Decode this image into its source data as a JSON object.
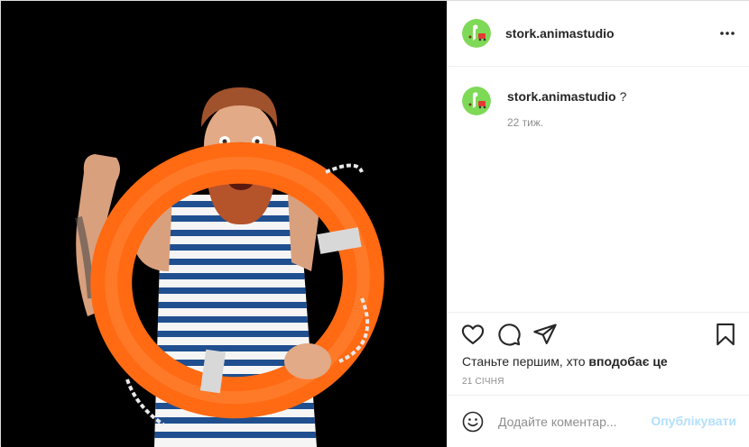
{
  "post": {
    "image": {
      "alt_icon": "post-photo",
      "background": "#000000"
    },
    "header": {
      "username": "stork.animastudio",
      "avatar_icon": "stork-logo-avatar",
      "more_icon": "more-options-icon"
    },
    "caption": {
      "username": "stork.animastudio",
      "text": "?",
      "time_ago": "22 тиж."
    },
    "actions": {
      "like_icon": "heart-icon",
      "comment_icon": "comment-bubble-icon",
      "share_icon": "paper-plane-icon",
      "save_icon": "bookmark-icon"
    },
    "likes_prefix": "Станьте першим, хто ",
    "likes_bold": "вподобає це",
    "date": "21 СІЧНЯ",
    "comment_box": {
      "placeholder": "Додайте коментар...",
      "emoji_icon": "smiley-icon",
      "publish_label": "Опублікувати"
    },
    "colors": {
      "accent_disabled": "#b2dffc",
      "muted_text": "#8e8e8e",
      "avatar_green": "#7ed957"
    }
  }
}
